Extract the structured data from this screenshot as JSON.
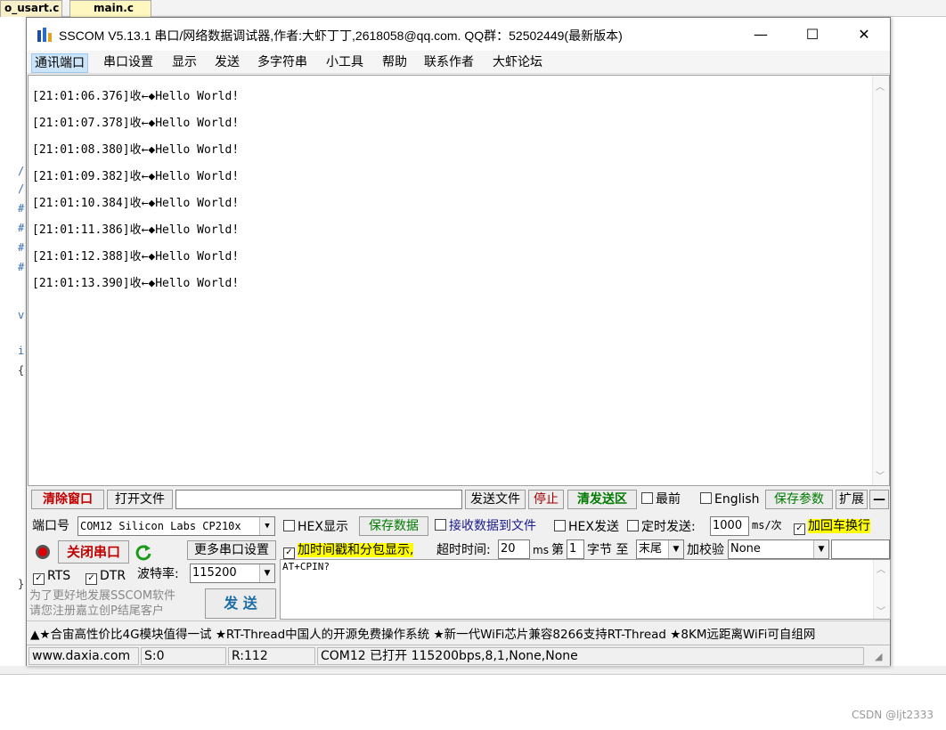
{
  "ide": {
    "tab1": "o_usart.c",
    "tab2": "main.c",
    "gutter_marks": [
      "/",
      "/",
      "#",
      "#",
      "#",
      "#",
      "v",
      "i",
      "{",
      "}"
    ],
    "watermark": "CSDN @ljt2333"
  },
  "window": {
    "title": "SSCOM V5.13.1 串口/网络数据调试器,作者:大虾丁丁,2618058@qq.com. QQ群：52502449(最新版本)",
    "minimize": "—",
    "maximize": "☐",
    "close": "✕"
  },
  "menu": [
    "通讯端口",
    "串口设置",
    "显示",
    "发送",
    "多字符串",
    "小工具",
    "帮助",
    "联系作者",
    "大虾论坛"
  ],
  "receive": {
    "lines": [
      "[21:01:06.376]收←◆Hello World!",
      "[21:01:07.378]收←◆Hello World!",
      "[21:01:08.380]收←◆Hello World!",
      "[21:01:09.382]收←◆Hello World!",
      "[21:01:10.384]收←◆Hello World!",
      "[21:01:11.386]收←◆Hello World!",
      "[21:01:12.388]收←◆Hello World!",
      "[21:01:13.390]收←◆Hello World!"
    ]
  },
  "toolbar1": {
    "clear": "清除窗口",
    "open_file": "打开文件",
    "send_file": "发送文件",
    "stop": "停止",
    "clear_send": "清发送区",
    "topmost": "最前",
    "english": "English",
    "save_params": "保存参数",
    "expand": "扩展",
    "collapse": "—"
  },
  "controls": {
    "port_label": "端口号",
    "port_value": "COM12 Silicon Labs CP210x",
    "hex_display": "HEX显示",
    "save_data": "保存数据",
    "recv_to_file": "接收数据到文件",
    "hex_send": "HEX发送",
    "timed_send": "定时发送:",
    "interval": "1000",
    "interval_unit": "ms/次",
    "add_crlf": "加回车换行",
    "close_port": "关闭串口",
    "more_settings": "更多串口设置",
    "timestamp": "加时间戳和分包显示,",
    "timeout_label": "超时时间:",
    "timeout_value": "20",
    "timeout_unit": "ms",
    "nth_label": "第",
    "nth_value": "1",
    "byte_label": "字节 至",
    "end_value": "末尾",
    "checksum_label": "加校验",
    "checksum_value": "None",
    "rts": "RTS",
    "dtr": "DTR",
    "baud_label": "波特率:",
    "baud_value": "115200",
    "promo1": "为了更好地发展SSCOM软件",
    "promo2": "请您注册嘉立创P结尾客户",
    "send": "发  送",
    "send_text": "AT+CPIN?"
  },
  "ad": "▲★合宙高性价比4G模块值得一试 ★RT-Thread中国人的开源免费操作系统 ★新一代WiFi芯片兼容8266支持RT-Thread ★8KM远距离WiFi可自组网",
  "status": {
    "site": "www.daxia.com",
    "sent": "S:0",
    "recv": "R:112",
    "port_info": "COM12 已打开  115200bps,8,1,None,None"
  }
}
